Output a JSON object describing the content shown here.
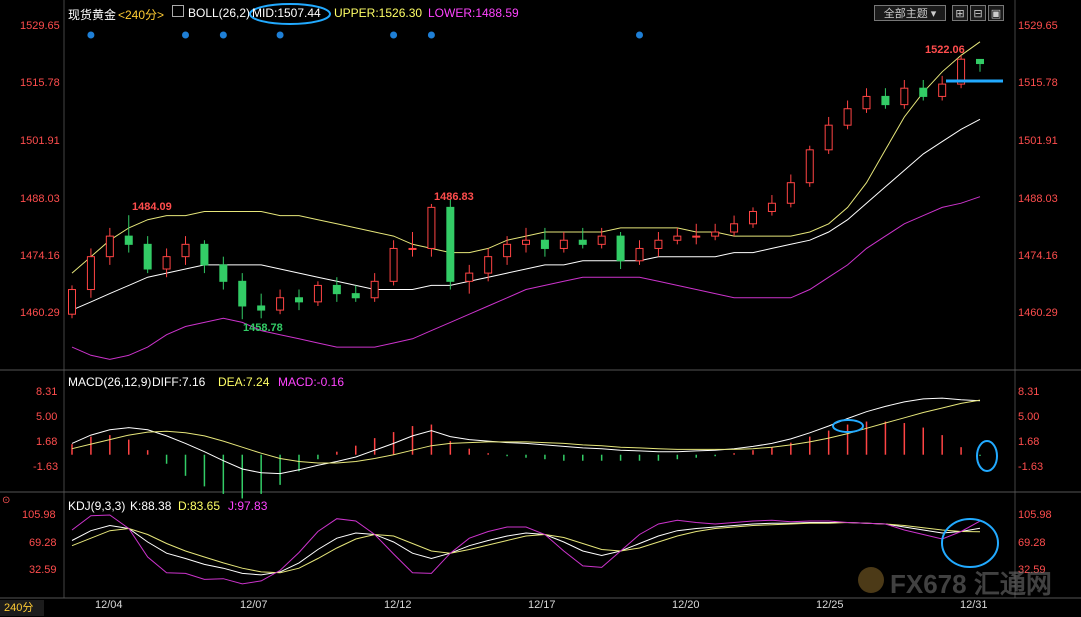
{
  "main_header": {
    "symbol": "现货黄金",
    "period": "<240分>",
    "boll_label": "BOLL(26,2)",
    "mid": "MID:1507.44",
    "upper": "UPPER:1526.30",
    "lower": "LOWER:1488.59"
  },
  "toolbar": {
    "theme_label": "全部主题"
  },
  "macd_header": {
    "label": "MACD(26,12,9)",
    "diff": "DIFF:7.16",
    "dea": "DEA:7.24",
    "macd": "MACD:-0.16"
  },
  "kdj_header": {
    "label": "KDJ(9,3,3)",
    "k": "K:88.38",
    "d": "D:83.65",
    "j": "J:97.83"
  },
  "period_tag": "240分",
  "watermark": "FX678 汇通网",
  "price_axis": [
    "1529.65",
    "1515.78",
    "1501.91",
    "1488.03",
    "1474.16",
    "1460.29"
  ],
  "macd_axis": [
    "8.31",
    "5.00",
    "1.68",
    "-1.63"
  ],
  "kdj_axis": [
    "105.98",
    "69.28",
    "32.59"
  ],
  "dates": [
    "12/04",
    "12/07",
    "12/12",
    "12/17",
    "12/20",
    "12/25",
    "12/31"
  ],
  "price_annotations": {
    "high_1": "1484.09",
    "low_1": "1458.78",
    "high_2": "1486.83",
    "high_3": "1522.06"
  },
  "colors": {
    "up": "#ff4444",
    "down": "#33cc66",
    "upper_band": "#e6e67a",
    "mid_band": "#ffffff",
    "lower_band": "#cc33cc",
    "highlight": "#22aaff"
  },
  "chart_data": [
    {
      "type": "candlestick",
      "title": "现货黄金 240分",
      "ylim": [
        1455,
        1532
      ],
      "y_ticks": [
        1529.65,
        1515.78,
        1501.91,
        1488.03,
        1474.16,
        1460.29
      ],
      "x_ticks": [
        "12/04",
        "12/07",
        "12/12",
        "12/17",
        "12/20",
        "12/25",
        "12/31"
      ],
      "series": [
        {
          "name": "UPPER",
          "values": [
            1470,
            1474,
            1478,
            1481,
            1483,
            1484,
            1484,
            1485,
            1485,
            1485,
            1485,
            1484,
            1484,
            1483,
            1482,
            1481,
            1480,
            1479,
            1477,
            1476,
            1475,
            1475,
            1476,
            1478,
            1479,
            1480,
            1480,
            1480,
            1480,
            1481,
            1481,
            1481,
            1481,
            1480,
            1480,
            1479,
            1479,
            1479,
            1479,
            1480,
            1482,
            1486,
            1492,
            1500,
            1508,
            1514,
            1519,
            1523,
            1526.3
          ]
        },
        {
          "name": "MID",
          "values": [
            1461,
            1463,
            1465,
            1467,
            1469,
            1470,
            1471,
            1472,
            1472,
            1472,
            1472,
            1471,
            1470,
            1469,
            1468,
            1467,
            1466,
            1466,
            1466,
            1467,
            1467,
            1468,
            1469,
            1470,
            1471,
            1472,
            1472,
            1473,
            1473,
            1473,
            1473,
            1474,
            1474,
            1474,
            1474,
            1475,
            1475,
            1476,
            1477,
            1478,
            1480,
            1483,
            1487,
            1491,
            1495,
            1499,
            1502,
            1505,
            1507.44
          ]
        },
        {
          "name": "LOWER",
          "values": [
            1452,
            1450,
            1449,
            1450,
            1452,
            1455,
            1457,
            1458,
            1459,
            1458,
            1456,
            1455,
            1454,
            1453,
            1452,
            1452,
            1452,
            1453,
            1454,
            1456,
            1458,
            1460,
            1462,
            1464,
            1466,
            1467,
            1468,
            1469,
            1469,
            1469,
            1469,
            1468,
            1467,
            1466,
            1465,
            1464,
            1464,
            1464,
            1464,
            1466,
            1469,
            1472,
            1476,
            1479,
            1482,
            1484,
            1486,
            1487,
            1488.59
          ]
        }
      ],
      "candles": [
        [
          1460,
          1466,
          1459,
          1467
        ],
        [
          1466,
          1474,
          1464,
          1476
        ],
        [
          1474,
          1479,
          1472,
          1481
        ],
        [
          1479,
          1477,
          1475,
          1484.09
        ],
        [
          1477,
          1471,
          1470,
          1479
        ],
        [
          1471,
          1474,
          1469,
          1476
        ],
        [
          1474,
          1477,
          1472,
          1479
        ],
        [
          1477,
          1472,
          1470,
          1478
        ],
        [
          1472,
          1468,
          1466,
          1474
        ],
        [
          1468,
          1462,
          1458.78,
          1470
        ],
        [
          1462,
          1461,
          1459,
          1465
        ],
        [
          1461,
          1464,
          1460,
          1466
        ],
        [
          1464,
          1463,
          1461,
          1466
        ],
        [
          1463,
          1467,
          1462,
          1468
        ],
        [
          1467,
          1465,
          1463,
          1469
        ],
        [
          1465,
          1464,
          1463,
          1467
        ],
        [
          1464,
          1468,
          1463,
          1470
        ],
        [
          1468,
          1476,
          1467,
          1478
        ],
        [
          1476,
          1476,
          1474,
          1480
        ],
        [
          1476,
          1486,
          1474,
          1486.83
        ],
        [
          1486,
          1468,
          1466,
          1488
        ],
        [
          1468,
          1470,
          1465,
          1472
        ],
        [
          1470,
          1474,
          1468,
          1476
        ],
        [
          1474,
          1477,
          1472,
          1479
        ],
        [
          1477,
          1478,
          1475,
          1481
        ],
        [
          1478,
          1476,
          1474,
          1481
        ],
        [
          1476,
          1478,
          1475,
          1480
        ],
        [
          1478,
          1477,
          1476,
          1481
        ],
        [
          1477,
          1479,
          1476,
          1481
        ],
        [
          1479,
          1473,
          1471,
          1480
        ],
        [
          1473,
          1476,
          1472,
          1478
        ],
        [
          1476,
          1478,
          1474,
          1480
        ],
        [
          1478,
          1479,
          1477,
          1481
        ],
        [
          1479,
          1479,
          1477,
          1482
        ],
        [
          1479,
          1480,
          1478,
          1482
        ],
        [
          1480,
          1482,
          1479,
          1484
        ],
        [
          1482,
          1485,
          1481,
          1486
        ],
        [
          1485,
          1487,
          1484,
          1489
        ],
        [
          1487,
          1492,
          1486,
          1494
        ],
        [
          1492,
          1500,
          1491,
          1501
        ],
        [
          1500,
          1506,
          1499,
          1508
        ],
        [
          1506,
          1510,
          1505,
          1512
        ],
        [
          1510,
          1513,
          1509,
          1515
        ],
        [
          1513,
          1511,
          1510,
          1515
        ],
        [
          1511,
          1515,
          1510,
          1517
        ],
        [
          1515,
          1513,
          1512,
          1517
        ],
        [
          1513,
          1516,
          1512,
          1518
        ],
        [
          1516,
          1522.06,
          1515,
          1523
        ],
        [
          1522,
          1521,
          1519,
          1522
        ]
      ],
      "annotations": [
        "1484.09",
        "1458.78",
        "1486.83",
        "1522.06"
      ]
    },
    {
      "type": "bar",
      "title": "MACD(26,12,9)",
      "ylim": [
        -5,
        9
      ],
      "y_ticks": [
        8.31,
        5.0,
        1.68,
        -1.63
      ],
      "series": [
        {
          "name": "DIFF",
          "values": [
            1.5,
            2.6,
            3.3,
            3.6,
            3.3,
            2.5,
            1.5,
            0.4,
            -0.8,
            -1.9,
            -2.4,
            -2.5,
            -2.0,
            -1.4,
            -0.9,
            -0.3,
            0.6,
            1.5,
            2.5,
            3.2,
            2.4,
            2.0,
            1.8,
            1.6,
            1.5,
            1.3,
            1.1,
            0.9,
            0.8,
            0.6,
            0.5,
            0.4,
            0.4,
            0.5,
            0.6,
            0.8,
            1.1,
            1.5,
            2.1,
            2.9,
            3.8,
            4.8,
            5.7,
            6.4,
            7.0,
            7.4,
            7.5,
            7.3,
            7.16
          ]
        },
        {
          "name": "DEA",
          "values": [
            0.8,
            1.4,
            2.0,
            2.6,
            3.0,
            3.1,
            2.9,
            2.5,
            1.8,
            1.0,
            0.2,
            -0.5,
            -0.9,
            -1.1,
            -1.1,
            -0.9,
            -0.5,
            0.0,
            0.6,
            1.2,
            1.5,
            1.6,
            1.7,
            1.7,
            1.7,
            1.6,
            1.5,
            1.3,
            1.2,
            1.0,
            0.9,
            0.8,
            0.7,
            0.7,
            0.7,
            0.7,
            0.8,
            1.0,
            1.3,
            1.7,
            2.2,
            2.8,
            3.5,
            4.2,
            4.9,
            5.6,
            6.2,
            6.8,
            7.24
          ]
        },
        {
          "name": "MACD",
          "values": [
            1.4,
            2.4,
            2.6,
            2.0,
            0.6,
            -1.2,
            -2.8,
            -4.2,
            -5.2,
            -5.8,
            -5.2,
            -4.0,
            -2.2,
            -0.6,
            0.4,
            1.2,
            2.2,
            3.0,
            3.8,
            4.0,
            1.8,
            0.8,
            0.2,
            -0.2,
            -0.4,
            -0.6,
            -0.8,
            -0.8,
            -0.8,
            -0.8,
            -0.8,
            -0.8,
            -0.6,
            -0.4,
            -0.2,
            0.2,
            0.6,
            1.0,
            1.6,
            2.4,
            3.2,
            4.0,
            4.4,
            4.4,
            4.2,
            3.6,
            2.6,
            1.0,
            -0.16
          ]
        }
      ]
    },
    {
      "type": "line",
      "title": "KDJ(9,3,3)",
      "ylim": [
        10,
        120
      ],
      "y_ticks": [
        105.98,
        69.28,
        32.59
      ],
      "series": [
        {
          "name": "K",
          "values": [
            72,
            85,
            92,
            88,
            70,
            55,
            48,
            40,
            35,
            28,
            26,
            30,
            42,
            60,
            75,
            82,
            80,
            70,
            55,
            48,
            55,
            65,
            72,
            78,
            82,
            80,
            70,
            58,
            52,
            58,
            68,
            78,
            85,
            88,
            90,
            92,
            94,
            95,
            95,
            96,
            96,
            96,
            95,
            94,
            90,
            86,
            82,
            84,
            88.38
          ]
        },
        {
          "name": "D",
          "values": [
            65,
            75,
            85,
            88,
            80,
            68,
            58,
            50,
            42,
            35,
            30,
            29,
            35,
            48,
            62,
            74,
            80,
            78,
            68,
            58,
            55,
            60,
            66,
            72,
            78,
            80,
            76,
            68,
            60,
            58,
            62,
            70,
            78,
            84,
            88,
            90,
            92,
            93,
            94,
            95,
            95,
            96,
            95,
            94,
            92,
            89,
            86,
            84,
            83.65
          ]
        },
        {
          "name": "J",
          "values": [
            86,
            105,
            106,
            88,
            50,
            29,
            28,
            20,
            21,
            14,
            18,
            32,
            56,
            84,
            101,
            98,
            80,
            54,
            29,
            28,
            55,
            75,
            84,
            90,
            90,
            80,
            58,
            38,
            36,
            58,
            80,
            94,
            99,
            96,
            94,
            96,
            98,
            99,
            97,
            98,
            98,
            96,
            95,
            94,
            86,
            80,
            74,
            84,
            97.83
          ]
        }
      ]
    }
  ]
}
